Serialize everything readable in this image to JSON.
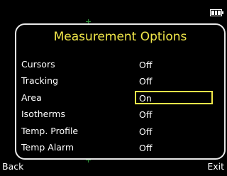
{
  "status": {
    "battery_icon": "battery-icon",
    "battery_level": 1.0
  },
  "menu": {
    "title": "Measurement Options",
    "options": [
      {
        "label": "Cursors",
        "value": "Off",
        "selected": false
      },
      {
        "label": "Tracking",
        "value": "Off",
        "selected": false
      },
      {
        "label": "Area",
        "value": "On",
        "selected": true
      },
      {
        "label": "Isotherms",
        "value": "Off",
        "selected": false
      },
      {
        "label": "Temp. Profile",
        "value": "Off",
        "selected": false
      },
      {
        "label": "Temp Alarm",
        "value": "Off",
        "selected": false
      }
    ]
  },
  "softkeys": {
    "left": "Back",
    "right": "Exit"
  },
  "colors": {
    "background": "#000000",
    "title": "#f2e84a",
    "selection_border": "#f2e84a",
    "panel_border": "#e8e8e8",
    "text": "#ffffff",
    "crosshair": "#2f8f3a"
  }
}
